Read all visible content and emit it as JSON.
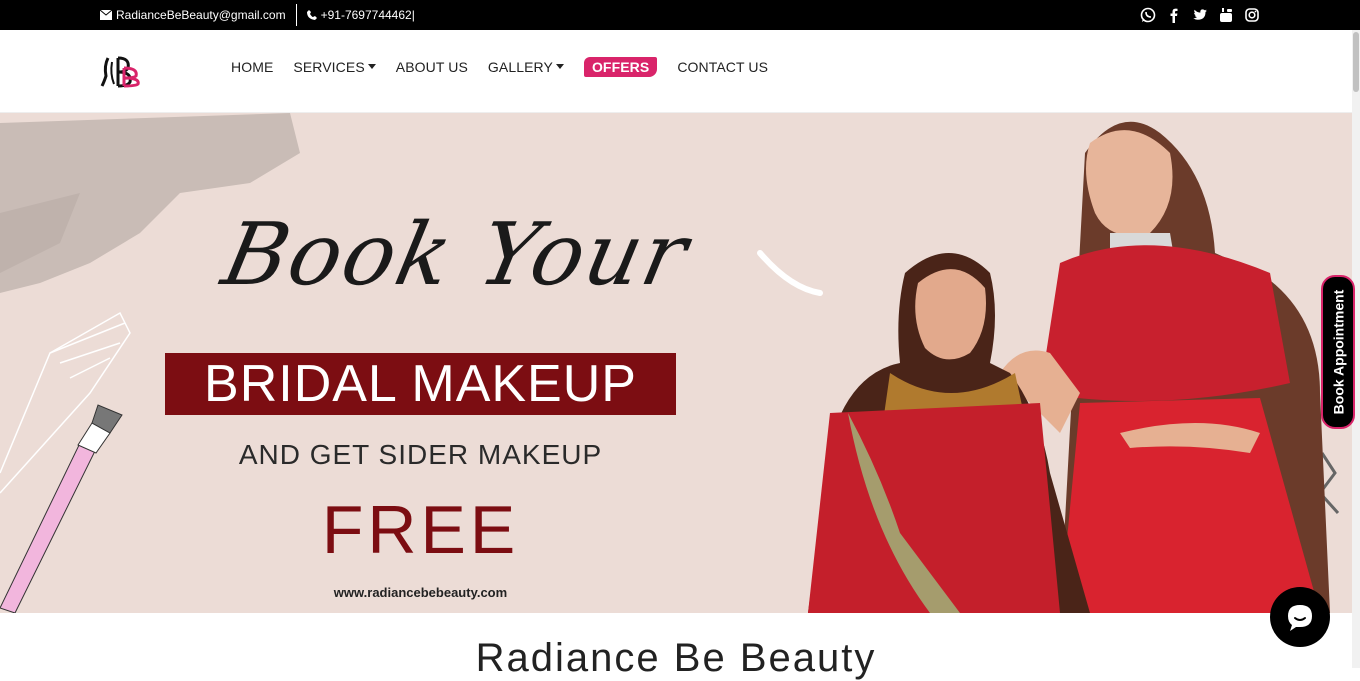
{
  "topbar": {
    "email": "RadianceBeBeauty@gmail.com",
    "phone": "+91-7697744462|",
    "socials": [
      {
        "icon": "whatsapp-icon"
      },
      {
        "icon": "facebook-icon"
      },
      {
        "icon": "twitter-icon"
      },
      {
        "icon": "youtube-icon"
      },
      {
        "icon": "instagram-icon"
      }
    ]
  },
  "nav": {
    "home": "HOME",
    "services": "SERVICES",
    "about": "ABOUT US",
    "gallery": "GALLERY",
    "offers": "OFFERS",
    "contact": "CONTACT US"
  },
  "hero": {
    "script": "Book Your",
    "headline": "BRIDAL MAKEUP",
    "subline": "AND GET SIDER MAKEUP",
    "free": "FREE",
    "url": "www.radiancebebeauty.com"
  },
  "side_tab": "Book Appointment",
  "site_title": "Radiance Be Beauty",
  "colors": {
    "accent": "#d9246a",
    "maroon": "#7c0d12",
    "hero_bg": "#ecdcd6"
  }
}
